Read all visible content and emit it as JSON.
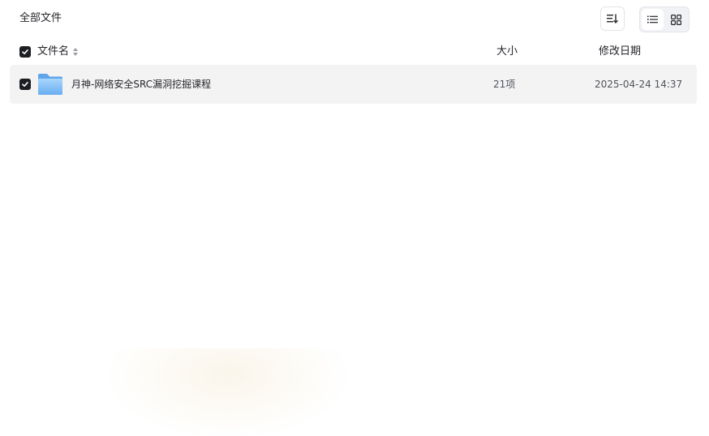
{
  "breadcrumb": {
    "label": "全部文件"
  },
  "toolbar": {
    "sort_icon": "sort-icon",
    "view_modes": [
      {
        "name": "list-view-icon",
        "active": true
      },
      {
        "name": "grid-view-icon",
        "active": false
      }
    ]
  },
  "table": {
    "select_all_checked": true,
    "columns": {
      "name": "文件名",
      "size": "大小",
      "modified": "修改日期"
    },
    "rows": [
      {
        "icon": "folder-icon",
        "checked": true,
        "name": "月神-网络安全SRC漏洞挖掘课程",
        "size": "21项",
        "modified": "2025-04-24 14:37"
      }
    ]
  },
  "colors": {
    "checkbox": "#1d1e22",
    "row_highlight": "#f3f3f4",
    "folder_top": "#9fd0fb",
    "folder_bottom": "#6fb1f2",
    "text_primary": "#25262b",
    "text_secondary": "#50535a"
  }
}
